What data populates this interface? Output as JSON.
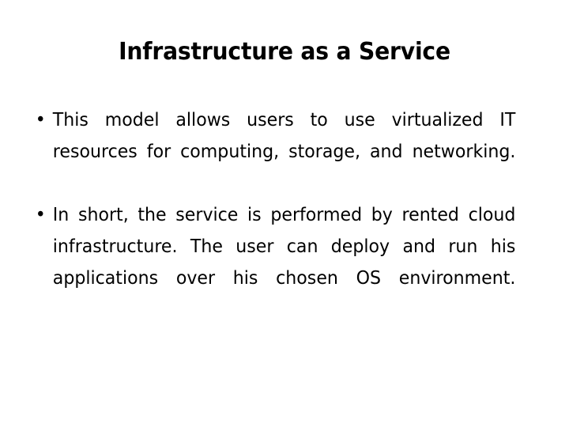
{
  "slide": {
    "title": "Infrastructure as a Service",
    "background_color": "#ffffff",
    "text_color": "#000000",
    "bullet_glyph": "•",
    "bullets": [
      {
        "text": "This model allows users to use virtualized IT resources for computing, storage, and networking."
      },
      {
        "text": "In short, the service is performed by rented cloud infrastructure. The user can deploy and run his applications over his chosen OS environment."
      }
    ]
  }
}
